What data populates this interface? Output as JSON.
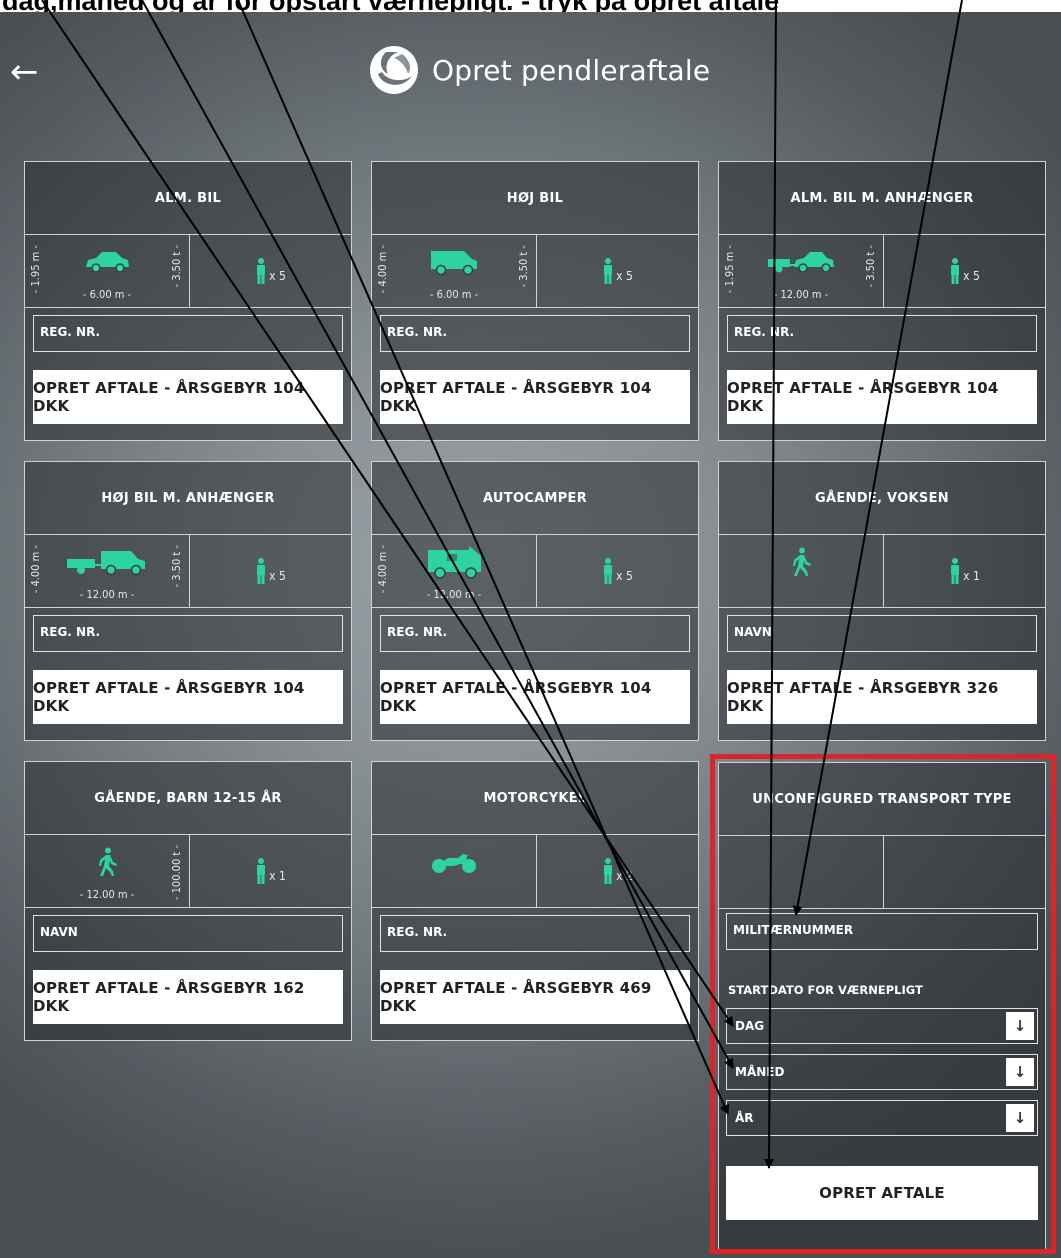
{
  "annotation": "dag,måned og år for opstart værnepligt. - tryk på opret aftale",
  "header": {
    "back_icon": "←",
    "title": "Opret pendleraftale"
  },
  "colors": {
    "accent": "#2ed3a4",
    "highlight_border": "#d9262a"
  },
  "cards": [
    {
      "title": "ALM. BIL",
      "height_label": "- 1.95 m -",
      "length_label": "- 6.00 m -",
      "weight_label": "- 3.50 t -",
      "persons": "x 5",
      "field_placeholder": "REG. NR.",
      "button": "OPRET AFTALE - ÅRSGEBYR 104 DKK",
      "vehicle_icon": "car-icon"
    },
    {
      "title": "HØJ BIL",
      "height_label": "- 4.00 m -",
      "length_label": "- 6.00 m -",
      "weight_label": "- 3.50 t -",
      "persons": "x 5",
      "field_placeholder": "REG. NR.",
      "button": "OPRET AFTALE - ÅRSGEBYR 104 DKK",
      "vehicle_icon": "van-icon"
    },
    {
      "title": "ALM. BIL M. ANHÆNGER",
      "height_label": "- 1.95 m -",
      "length_label": "- 12.00 m -",
      "weight_label": "- 3.50 t -",
      "persons": "x 5",
      "field_placeholder": "REG. NR.",
      "button": "OPRET AFTALE - ÅRSGEBYR 104 DKK",
      "vehicle_icon": "car-trailer-icon"
    },
    {
      "title": "HØJ BIL M. ANHÆNGER",
      "height_label": "- 4.00 m -",
      "length_label": "- 12.00 m -",
      "weight_label": "- 3.50 t -",
      "persons": "x 5",
      "field_placeholder": "REG. NR.",
      "button": "OPRET AFTALE - ÅRSGEBYR 104 DKK",
      "vehicle_icon": "van-trailer-icon"
    },
    {
      "title": "AUTOCAMPER",
      "height_label": "- 4.00 m -",
      "length_label": "- 12.00 m -",
      "weight_label": "",
      "persons": "x 5",
      "field_placeholder": "REG. NR.",
      "button": "OPRET AFTALE - ÅRSGEBYR 104 DKK",
      "vehicle_icon": "camper-icon"
    },
    {
      "title": "GÅENDE, VOKSEN",
      "height_label": "",
      "length_label": "",
      "weight_label": "",
      "persons": "x 1",
      "field_placeholder": "NAVN",
      "button": "OPRET AFTALE - ÅRSGEBYR 326 DKK",
      "vehicle_icon": "pedestrian-icon"
    },
    {
      "title": "GÅENDE, BARN 12-15 ÅR",
      "height_label": "",
      "length_label": "- 12.00 m -",
      "weight_label": "- 100.00 t -",
      "persons": "x 1",
      "field_placeholder": "NAVN",
      "button": "OPRET AFTALE - ÅRSGEBYR 162 DKK",
      "vehicle_icon": "pedestrian-icon"
    },
    {
      "title": "MOTORCYKEL",
      "height_label": "",
      "length_label": "",
      "weight_label": "",
      "persons": "x 2",
      "field_placeholder": "REG. NR.",
      "button": "OPRET AFTALE - ÅRSGEBYR 469 DKK",
      "vehicle_icon": "motorcycle-icon"
    }
  ],
  "special_card": {
    "title": "UNCONFIGURED TRANSPORT TYPE",
    "field_placeholder": "MILITÆRNUMMER",
    "start_label": "STARTDATO FOR VÆRNEPLIGT",
    "selects": [
      "DAG",
      "MÅNED",
      "ÅR"
    ],
    "button": "OPRET AFTALE"
  }
}
